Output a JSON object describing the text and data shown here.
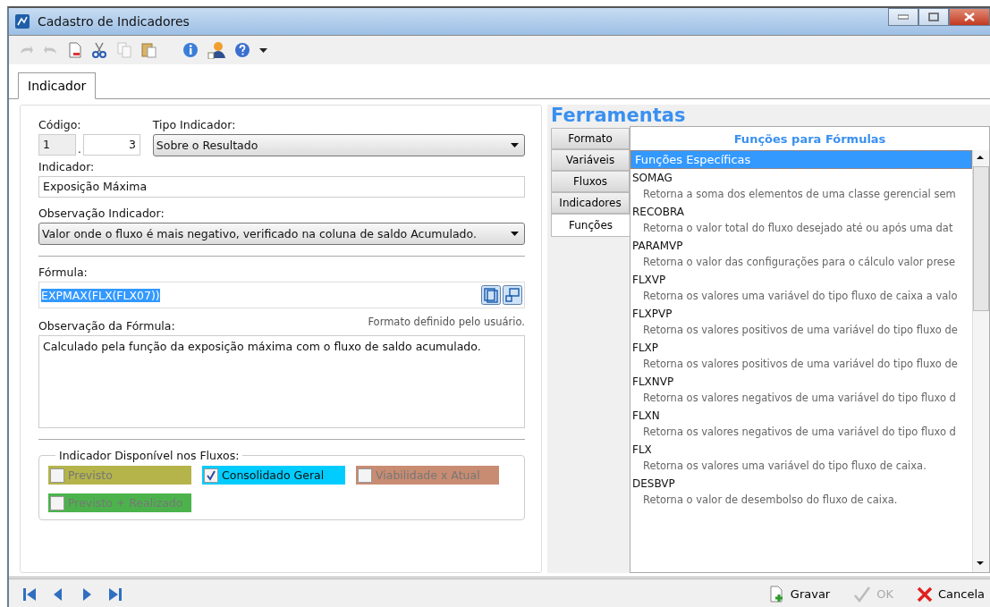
{
  "window": {
    "title": "Cadastro de Indicadores"
  },
  "toolbar": [
    {
      "kind": "undo",
      "disabled": true
    },
    {
      "kind": "redo",
      "disabled": true
    },
    {
      "kind": "new",
      "disabled": false
    },
    {
      "kind": "cut",
      "disabled": false
    },
    {
      "kind": "copy",
      "disabled": true
    },
    {
      "kind": "paste",
      "disabled": false
    },
    {
      "kind": "info",
      "disabled": false
    },
    {
      "kind": "user",
      "disabled": false
    },
    {
      "kind": "help",
      "disabled": false
    }
  ],
  "tabs": [
    {
      "label": "Indicador",
      "selected": true
    }
  ],
  "form": {
    "codigo": {
      "label": "Código:",
      "part1": "1",
      "separator": ".",
      "part2": "3"
    },
    "tipo": {
      "label": "Tipo Indicador:",
      "value": "Sobre o Resultado"
    },
    "indicador": {
      "label": "Indicador:",
      "value": "Exposição Máxima"
    },
    "observacao_indicador": {
      "label": "Observação Indicador:",
      "value": "Valor onde o fluxo é mais negativo, verificado na coluna de saldo Acumulado."
    },
    "formula": {
      "label": "Fórmula:",
      "value": "EXPMAX(FLX(FLX07))",
      "selected": true
    },
    "formato_note": "Formato definido pelo usuário.",
    "observacao_formula": {
      "label": "Observação da Fórmula:",
      "value": "Calculado pela função da exposição máxima com o fluxo de saldo acumulado."
    },
    "fluxos": {
      "label": "Indicador Disponível nos Fluxos:",
      "items": [
        {
          "label": "Previsto",
          "checked": false,
          "disabled": true,
          "color": "#b4b44a"
        },
        {
          "label": "Consolidado Geral",
          "checked": true,
          "disabled": false,
          "color": "#00ccff"
        },
        {
          "label": "Viabilidade x Atual",
          "checked": false,
          "disabled": true,
          "color": "#c88c72"
        },
        {
          "label": "Previsto + Realizado",
          "checked": false,
          "disabled": true,
          "color": "#4cb34c"
        }
      ]
    }
  },
  "ferramentas": {
    "title": "Ferramentas",
    "tabs": [
      {
        "label": "Formato",
        "selected": false
      },
      {
        "label": "Variáveis",
        "selected": false
      },
      {
        "label": "Fluxos",
        "selected": false
      },
      {
        "label": "Indicadores",
        "selected": false
      },
      {
        "label": "Funções",
        "selected": true
      }
    ],
    "panel_title": "Funções para Fórmulas",
    "group": {
      "label": "Funções Específicas",
      "selected": true
    },
    "functions": [
      {
        "name": "SOMAG",
        "description": "Retorna a soma dos elementos de uma classe gerencial sem"
      },
      {
        "name": "RECOBRA",
        "description": "Retorna o valor total do fluxo desejado até ou após uma dat"
      },
      {
        "name": "PARAMVP",
        "description": "Retorna o valor das configurações para o cálculo valor prese"
      },
      {
        "name": "FLXVP",
        "description": "Retorna os valores uma variável do tipo fluxo de caixa a valo"
      },
      {
        "name": "FLXPVP",
        "description": "Retorna os valores positivos de uma variável do tipo fluxo de"
      },
      {
        "name": "FLXP",
        "description": "Retorna os valores positivos de uma variável do tipo fluxo de"
      },
      {
        "name": "FLXNVP",
        "description": "Retorna os valores negativos de uma variável do tipo fluxo d"
      },
      {
        "name": "FLXN",
        "description": "Retorna os valores negativos de uma variável do tipo fluxo d"
      },
      {
        "name": "FLX",
        "description": "Retorna os valores uma variável do tipo fluxo de caixa."
      },
      {
        "name": "DESBVP",
        "description": "Retorna o valor de desembolso do fluxo de caixa."
      }
    ]
  },
  "navigation": [
    {
      "kind": "first"
    },
    {
      "kind": "prev"
    },
    {
      "kind": "next"
    },
    {
      "kind": "last"
    }
  ],
  "actions": [
    {
      "kind": "save",
      "label": "Gravar",
      "disabled": false
    },
    {
      "kind": "ok",
      "label": "OK",
      "disabled": true
    },
    {
      "kind": "cancel",
      "label": "Cancela",
      "disabled": false
    }
  ]
}
